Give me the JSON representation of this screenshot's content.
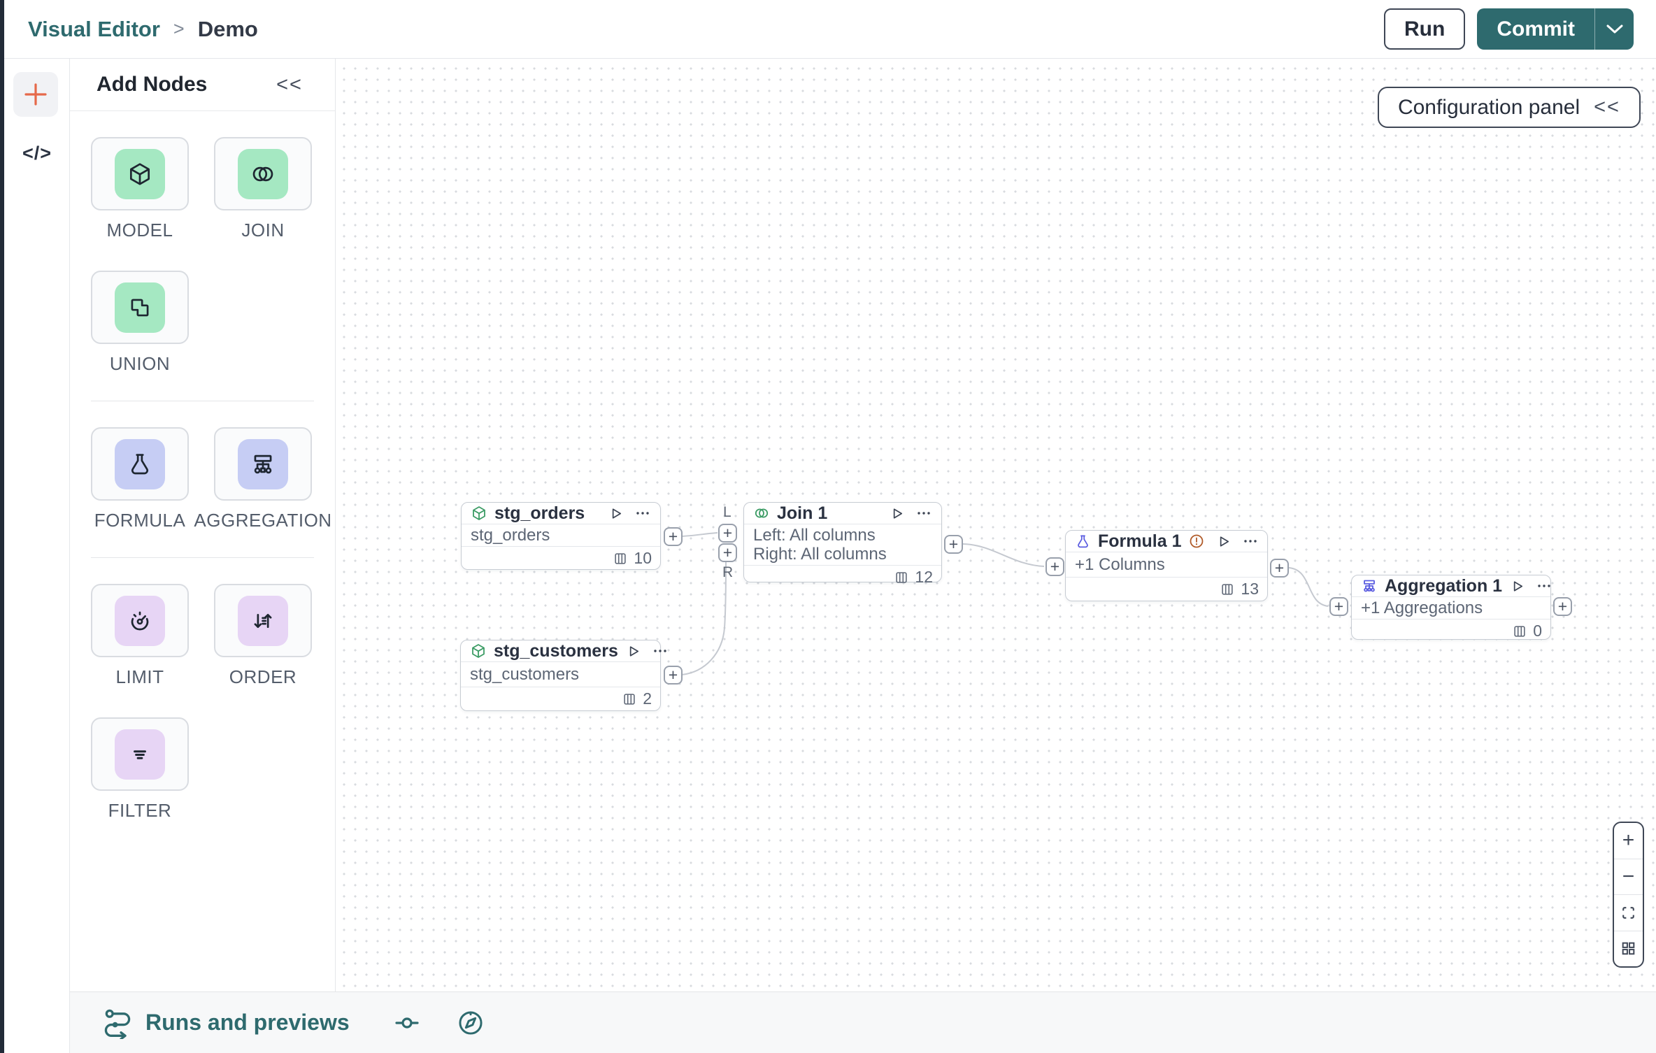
{
  "topbar": {
    "breadcrumb_root": "Visual Editor",
    "breadcrumb_separator": ">",
    "breadcrumb_current": "Demo",
    "run_label": "Run",
    "commit_label": "Commit"
  },
  "rail": {
    "code_glyph": "</>"
  },
  "palette": {
    "title": "Add Nodes",
    "collapse_glyph": "<<",
    "tiles": [
      {
        "label": "MODEL",
        "icon": "cube-icon",
        "color": "green"
      },
      {
        "label": "JOIN",
        "icon": "join-circles-icon",
        "color": "green"
      },
      {
        "label": "UNION",
        "icon": "union-squares-icon",
        "color": "green"
      },
      {
        "label": "FORMULA",
        "icon": "flask-icon",
        "color": "periwinkle"
      },
      {
        "label": "AGGREGATION",
        "icon": "aggregation-tree-icon",
        "color": "periwinkle"
      },
      {
        "label": "LIMIT",
        "icon": "gauge-icon",
        "color": "lavender"
      },
      {
        "label": "ORDER",
        "icon": "sort-arrows-icon",
        "color": "lavender"
      },
      {
        "label": "FILTER",
        "icon": "filter-lines-icon",
        "color": "lavender"
      }
    ]
  },
  "canvas": {
    "config_panel_label": "Configuration panel",
    "config_collapse_glyph": "<<",
    "port_labels": {
      "left": "L",
      "right": "R"
    },
    "nodes": [
      {
        "title": "stg_orders",
        "icon": "cube-icon",
        "lines": [
          "stg_orders"
        ],
        "columns_count": "10"
      },
      {
        "title": "stg_customers",
        "icon": "cube-icon",
        "lines": [
          "stg_customers"
        ],
        "columns_count": "2"
      },
      {
        "title": "Join 1",
        "icon": "join-circles-icon",
        "lines": [
          "Left: All columns",
          "Right: All columns"
        ],
        "columns_count": "12"
      },
      {
        "title": "Formula 1",
        "icon": "flask-icon",
        "lines": [
          "+1 Columns"
        ],
        "columns_count": "13",
        "has_warning": true
      },
      {
        "title": "Aggregation 1",
        "icon": "aggregation-tree-icon",
        "lines": [
          "+1 Aggregations"
        ],
        "columns_count": "0"
      }
    ],
    "zoom_controls": {
      "zoom_in": "+",
      "zoom_out": "−"
    }
  },
  "bottombar": {
    "runs_label": "Runs and previews"
  },
  "glyphs": {
    "plus": "+"
  },
  "colors": {
    "accent_teal": "#2e6a6e",
    "tile_green": "#a5e8c2",
    "tile_periwinkle": "#c6cdf4",
    "tile_lavender": "#e7d5f5",
    "node_green_icon": "#3c9c65",
    "node_indigo_icon": "#5a5ce0",
    "warning_orange": "#b05a28",
    "add_plus_orange": "#e5694a",
    "edge_gray": "#c5c9d0"
  }
}
